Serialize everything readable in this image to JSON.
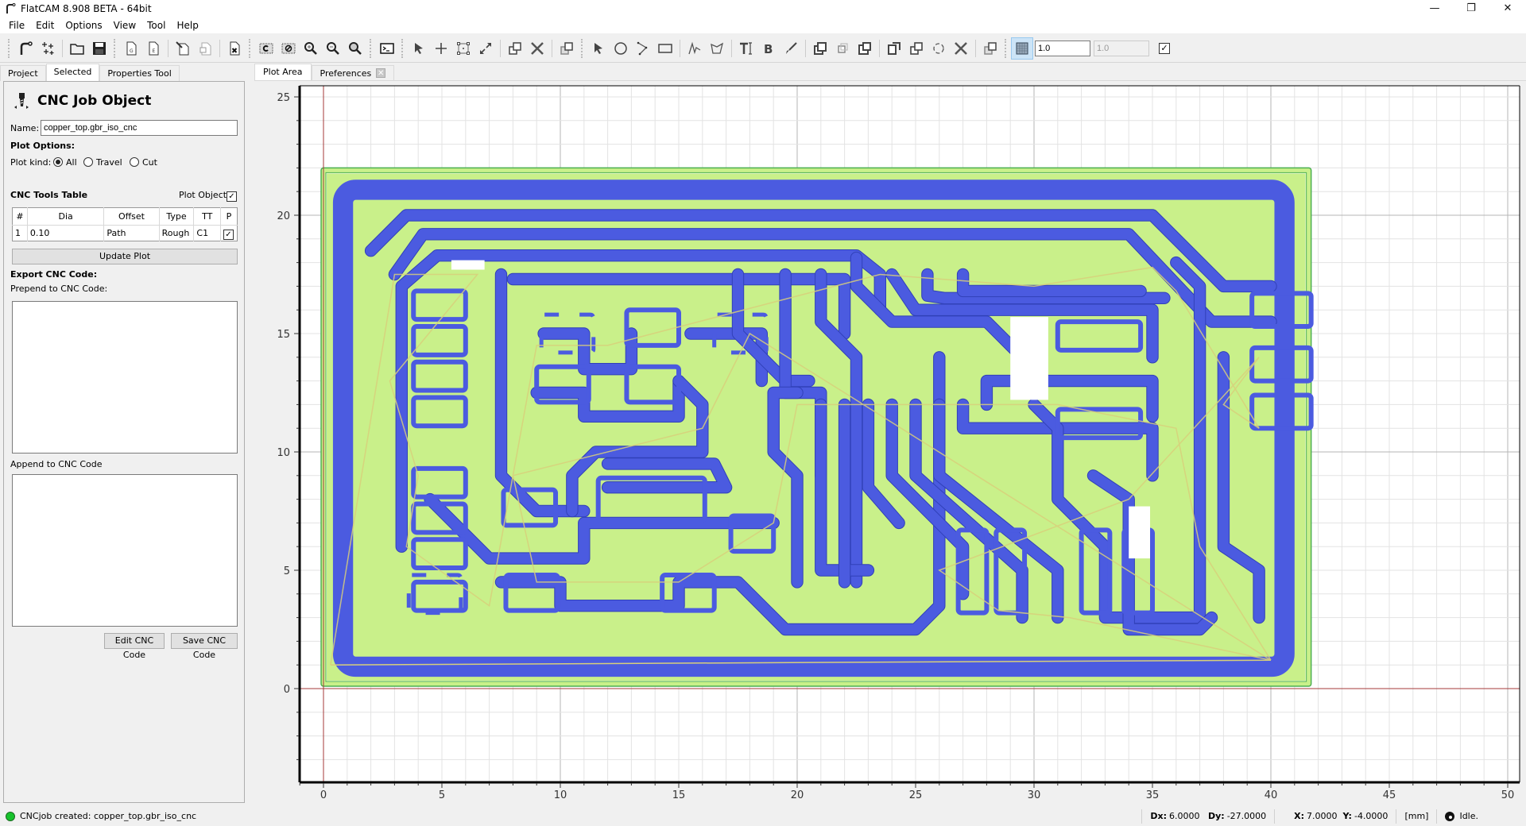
{
  "window": {
    "title": "FlatCAM 8.908 BETA - 64bit",
    "controls": {
      "minimize": "—",
      "restore": "❐",
      "close": "✕"
    }
  },
  "menu": [
    "File",
    "Edit",
    "Options",
    "View",
    "Tool",
    "Help"
  ],
  "toolbar": {
    "groups": [
      [
        "new-project-icon",
        "new-geometry-icon",
        "open-folder-icon",
        "save-icon"
      ],
      [
        "open-gcode-icon",
        "open-excellon-icon",
        "edit-object-icon",
        "paste-object-icon",
        "delete-object-icon"
      ],
      [
        "replot-icon",
        "clear-plot-icon",
        "zoom-in-icon",
        "zoom-out-icon",
        "zoom-fit-icon"
      ],
      [
        "shell-icon"
      ],
      [
        "select-icon",
        "add-point-icon",
        "add-array-icon",
        "resize-icon",
        "copy-icon",
        "delete-icon",
        "move-icon"
      ],
      [
        "select-shape-icon",
        "circle-icon",
        "arc-icon",
        "rectangle-icon",
        "path-icon",
        "polygon-icon",
        "text-icon",
        "buffer-icon",
        "paint-icon",
        "union-icon",
        "intersection-icon",
        "subtraction-icon",
        "cut-icon",
        "copy-shape-icon",
        "rotate-icon",
        "delete-shape-icon",
        "move-shape-icon"
      ]
    ],
    "snap_grid_active": true,
    "grid_x": "1.0",
    "grid_y": "1.0",
    "grid_lock_checked": true
  },
  "left_tabs": [
    {
      "label": "Project",
      "active": false
    },
    {
      "label": "Selected",
      "active": true
    },
    {
      "label": "Properties Tool",
      "active": false
    }
  ],
  "panel": {
    "title": "CNC Job Object",
    "name_label": "Name:",
    "name_value": "copper_top.gbr_iso_cnc",
    "plot_options_label": "Plot Options:",
    "plot_kind_label": "Plot kind:",
    "plot_kinds": [
      {
        "label": "All",
        "checked": true
      },
      {
        "label": "Travel",
        "checked": false
      },
      {
        "label": "Cut",
        "checked": false
      }
    ],
    "tools_table_label": "CNC Tools Table",
    "plot_object_label": "Plot Object",
    "plot_object_checked": true,
    "tools_table": {
      "headers": [
        "#",
        "Dia",
        "Offset",
        "Type",
        "TT",
        "P"
      ],
      "rows": [
        {
          "num": "1",
          "dia": "0.10",
          "offset": "Path",
          "type": "Rough",
          "tt": "C1",
          "plot": true
        }
      ]
    },
    "update_plot_label": "Update Plot",
    "export_label": "Export CNC Code:",
    "prepend_label": "Prepend to CNC Code:",
    "prepend_value": "",
    "append_label": "Append to CNC Code",
    "append_value": "",
    "edit_cnc_label": "Edit CNC Code",
    "save_cnc_label": "Save CNC Code"
  },
  "right_tabs": [
    {
      "label": "Plot Area",
      "active": true,
      "closable": false
    },
    {
      "label": "Preferences",
      "active": false,
      "closable": true
    }
  ],
  "plot": {
    "x_ticks": [
      "0",
      "5",
      "10",
      "15",
      "20",
      "25",
      "30",
      "35",
      "40",
      "45",
      "50"
    ],
    "y_ticks": [
      "0",
      "5",
      "10",
      "15",
      "20",
      "25"
    ],
    "x_range": [
      -1,
      50.3
    ],
    "y_range": [
      -3.5,
      26.5
    ],
    "units": "mm",
    "colors": {
      "board_fill": "#c9f08a",
      "board_edge": "#4caf50",
      "cut_path": "#4b5be0",
      "cut_path_edge": "#3141b8",
      "travel": "#d8cf7a",
      "axis_origin": "#a43a3a",
      "grid_minor": "#e3e3e3",
      "grid_major": "#b5b5b5"
    },
    "board": {
      "x0": -0.1,
      "y0": 0.1,
      "x1": 41.7,
      "y1": 22.0
    },
    "outline_ring": {
      "x0": 0.4,
      "y0": 0.5,
      "x1": 41.0,
      "y1": 21.5,
      "width": 0.85
    }
  },
  "status": {
    "message": "CNCjob created: copper_top.gbr_iso_cnc",
    "dx_label": "Dx:",
    "dx": "6.0000",
    "dy_label": "Dy:",
    "dy": "-27.0000",
    "x_label": "X:",
    "x": "7.0000",
    "y_label": "Y:",
    "y": "-4.0000",
    "units": "[mm]",
    "state": "Idle."
  }
}
